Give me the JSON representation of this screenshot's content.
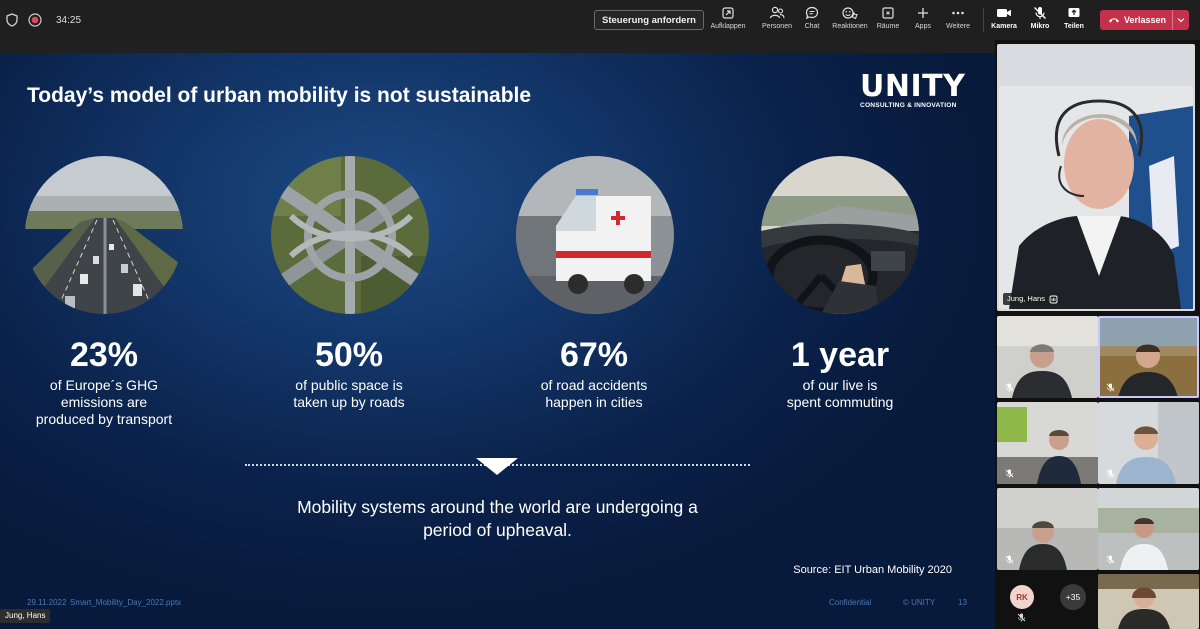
{
  "toolbar": {
    "timer": "34:25",
    "request_control_label": "Steuerung anfordern",
    "tools": [
      {
        "label": "Aufklappen",
        "icon": "expand-icon"
      },
      {
        "label": "Personen",
        "icon": "people-icon"
      },
      {
        "label": "Chat",
        "icon": "chat-icon"
      },
      {
        "label": "Reaktionen",
        "icon": "reactions-icon"
      },
      {
        "label": "Räume",
        "icon": "rooms-icon"
      },
      {
        "label": "Apps",
        "icon": "apps-icon"
      },
      {
        "label": "Weitere",
        "icon": "more-icon"
      },
      {
        "label": "Kamera",
        "icon": "camera-icon"
      },
      {
        "label": "Mikro",
        "icon": "mic-off-icon"
      },
      {
        "label": "Teilen",
        "icon": "share-icon"
      }
    ],
    "leave_label": "Verlassen",
    "leave_color": "#c4314b"
  },
  "slide": {
    "title": "Today’s model of urban mobility is not sustainable",
    "logo_main": "UNITY",
    "logo_sub": "CONSULTING & INNOVATION",
    "stats": [
      {
        "value": "23%",
        "lines": [
          "of Europe´s GHG",
          "emissions are",
          "produced by transport"
        ],
        "image": "highway-image"
      },
      {
        "value": "50%",
        "lines": [
          "of public space is",
          "taken up by roads"
        ],
        "image": "interchange-image"
      },
      {
        "value": "67%",
        "lines": [
          "of road accidents",
          "happen in cities"
        ],
        "image": "ambulance-image"
      },
      {
        "value": "1 year",
        "lines": [
          "of our live is",
          "spent commuting"
        ],
        "image": "driving-image"
      }
    ],
    "tagline_lines": [
      "Mobility systems around the world are undergoing a",
      "period of upheaval."
    ],
    "source": "Source: EIT Urban Mobility 2020",
    "footer": {
      "date": "29.11.2022",
      "file": "Smart_Mobility_Day_2022.pptx",
      "confidential": "Confidential",
      "copyright": "© UNITY",
      "page": "13"
    },
    "bg_color": "#0a2149"
  },
  "presenter_tag": "Jung, Hans",
  "participants": {
    "main_name": "Jung, Hans",
    "initials": "RK",
    "more_count": "+35"
  }
}
